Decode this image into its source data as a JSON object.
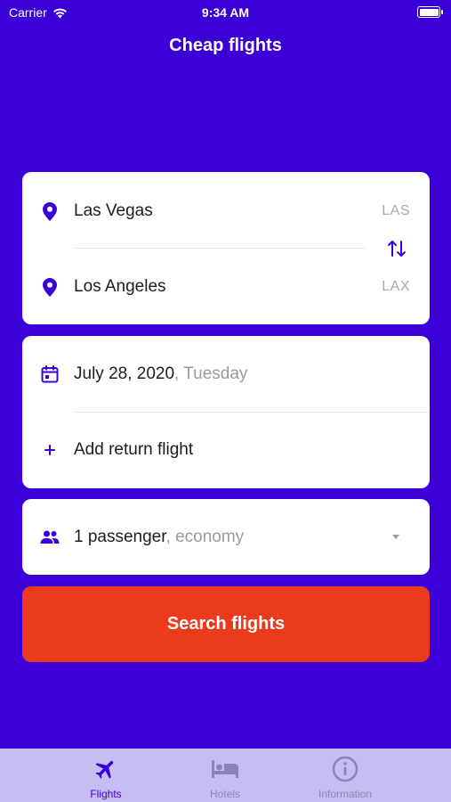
{
  "status_bar": {
    "carrier": "Carrier",
    "time": "9:34 AM"
  },
  "app": {
    "title": "Cheap flights"
  },
  "route": {
    "origin": {
      "city": "Las Vegas",
      "code": "LAS"
    },
    "destination": {
      "city": "Los Angeles",
      "code": "LAX"
    }
  },
  "dates": {
    "departure": {
      "date": "July 28, 2020",
      "day": ", Tuesday"
    },
    "add_return_label": "Add return flight"
  },
  "passengers": {
    "count_label": "1 passenger",
    "class_label": ", economy"
  },
  "search_button": {
    "label": "Search flights"
  },
  "tabs": [
    {
      "label": "Flights",
      "icon": "airplane-icon",
      "active": true
    },
    {
      "label": "Hotels",
      "icon": "bed-icon",
      "active": false
    },
    {
      "label": "Information",
      "icon": "info-icon",
      "active": false
    }
  ],
  "colors": {
    "background": "#3b00d8",
    "accent": "#3b00d8",
    "search_button": "#ec3a1c",
    "tabbar": "#c6bdf4"
  }
}
